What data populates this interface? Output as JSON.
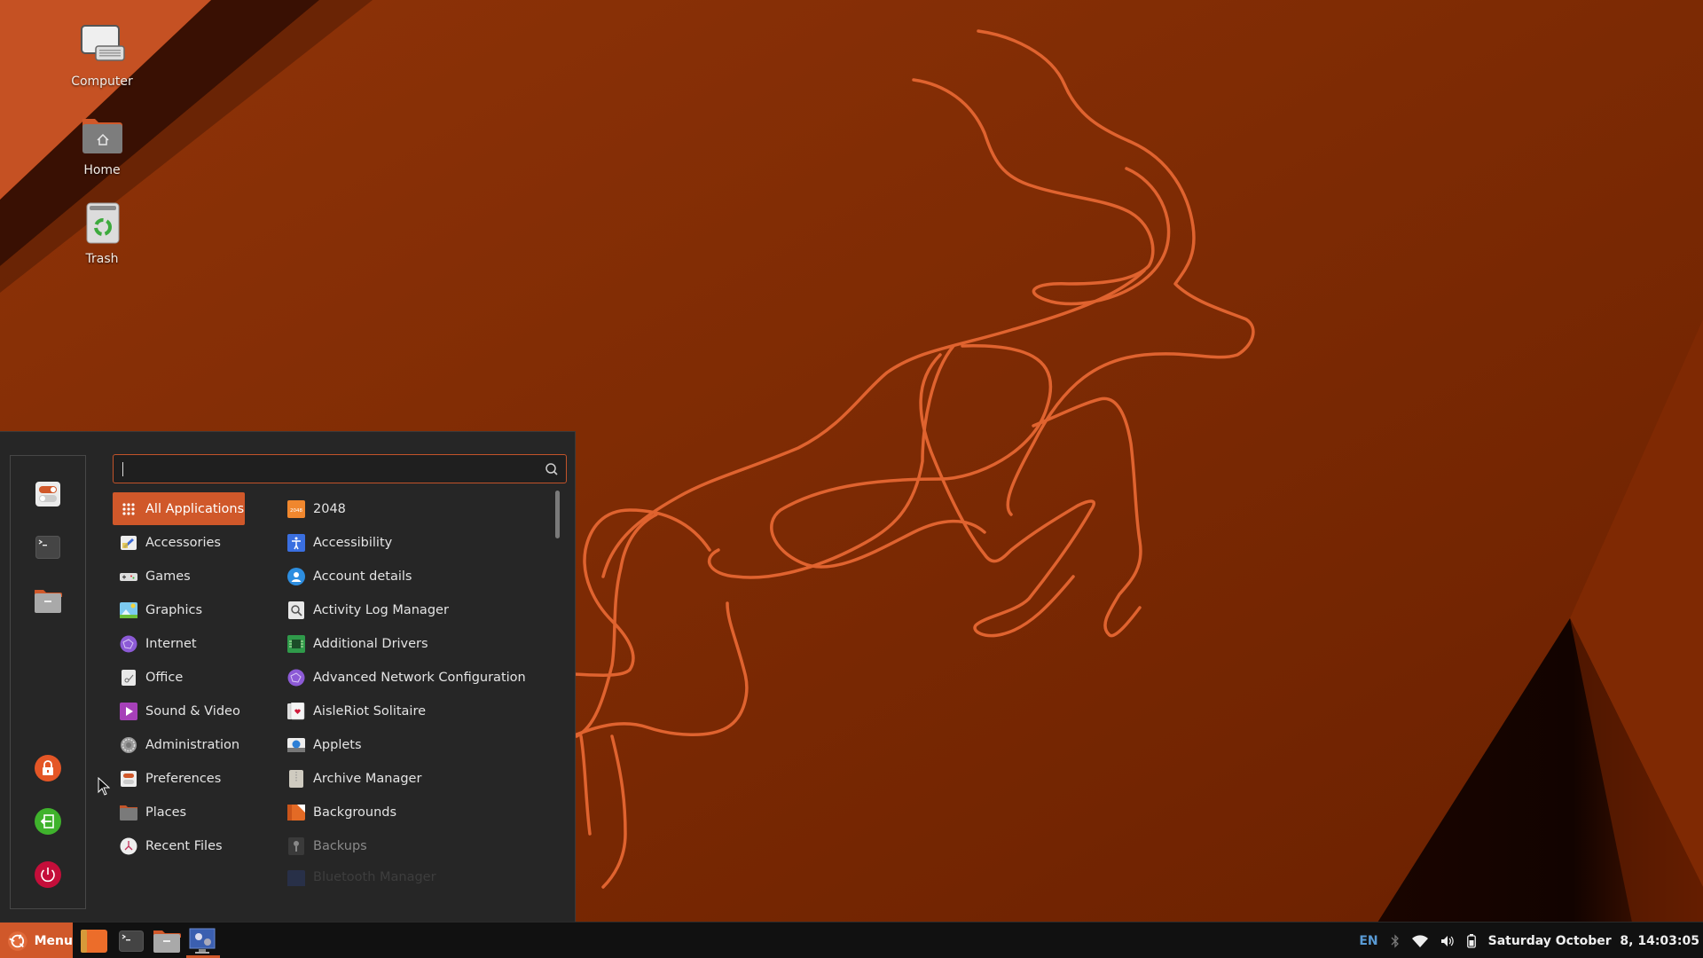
{
  "desktop": {
    "icons": [
      {
        "label": "Computer",
        "icon": "computer-icon"
      },
      {
        "label": "Home",
        "icon": "home-folder-icon"
      },
      {
        "label": "Trash",
        "icon": "trash-icon"
      }
    ]
  },
  "menu": {
    "search": {
      "value": "",
      "placeholder": ""
    },
    "sidebar": [
      {
        "name": "settings",
        "icon": "settings-toggle-icon"
      },
      {
        "name": "terminal",
        "icon": "terminal-icon"
      },
      {
        "name": "files",
        "icon": "folder-icon"
      },
      {
        "name": "lock-screen",
        "icon": "lock-icon"
      },
      {
        "name": "logout",
        "icon": "logout-icon"
      },
      {
        "name": "shutdown",
        "icon": "power-icon"
      }
    ],
    "categories": [
      {
        "label": "All Applications",
        "icon": "grid-icon",
        "active": true
      },
      {
        "label": "Accessories",
        "icon": "accessories-icon"
      },
      {
        "label": "Games",
        "icon": "gamepad-icon"
      },
      {
        "label": "Graphics",
        "icon": "graphics-icon"
      },
      {
        "label": "Internet",
        "icon": "globe-icon"
      },
      {
        "label": "Office",
        "icon": "office-icon"
      },
      {
        "label": "Sound & Video",
        "icon": "play-icon"
      },
      {
        "label": "Administration",
        "icon": "admin-gear-icon"
      },
      {
        "label": "Preferences",
        "icon": "preferences-icon"
      },
      {
        "label": "Places",
        "icon": "places-folder-icon"
      },
      {
        "label": "Recent Files",
        "icon": "recent-clock-icon"
      }
    ],
    "applications": [
      {
        "label": "2048",
        "icon": "game-2048-icon"
      },
      {
        "label": "Accessibility",
        "icon": "accessibility-icon"
      },
      {
        "label": "Account details",
        "icon": "account-icon"
      },
      {
        "label": "Activity Log Manager",
        "icon": "activity-log-icon"
      },
      {
        "label": "Additional Drivers",
        "icon": "chip-icon"
      },
      {
        "label": "Advanced Network Configuration",
        "icon": "network-icon"
      },
      {
        "label": "AisleRiot Solitaire",
        "icon": "cards-icon"
      },
      {
        "label": "Applets",
        "icon": "applets-icon"
      },
      {
        "label": "Archive Manager",
        "icon": "archive-icon"
      },
      {
        "label": "Backgrounds",
        "icon": "backgrounds-icon"
      },
      {
        "label": "Backups",
        "icon": "backups-icon",
        "dim": true
      },
      {
        "label": "Bluetooth Manager",
        "icon": "bluetooth-manager-icon",
        "faded": true
      }
    ]
  },
  "taskbar": {
    "menu_label": "Menu",
    "launchers": [
      {
        "name": "orange-app",
        "icon": "orange-app-icon"
      },
      {
        "name": "terminal",
        "icon": "terminal-icon"
      },
      {
        "name": "files",
        "icon": "folder-icon"
      },
      {
        "name": "system-settings",
        "icon": "display-settings-icon",
        "active": true
      }
    ],
    "tray": {
      "language": "EN",
      "clock": "Saturday October  8, 14:03:05"
    }
  },
  "colors": {
    "accent": "#d0582a",
    "menu_bg": "#262626",
    "taskbar_bg": "#111111"
  }
}
